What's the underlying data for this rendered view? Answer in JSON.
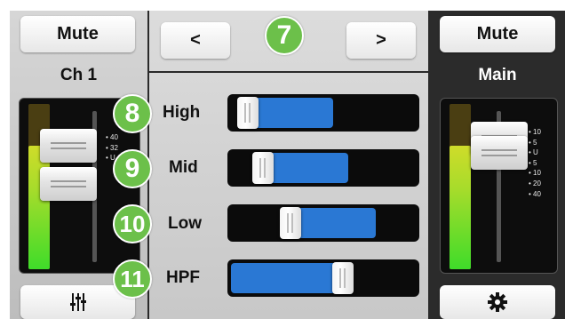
{
  "left_channel": {
    "mute_label": "Mute",
    "name": "Ch 1",
    "scale_marks": [
      "40",
      "32",
      "",
      "",
      "U",
      "",
      ""
    ],
    "fader_level": 0.58,
    "meter_level": 0.75,
    "settings_icon": "sliders-icon"
  },
  "center": {
    "prev_label": "<",
    "next_label": ">",
    "badge_top": "7",
    "eq": [
      {
        "badge": "8",
        "label": "High",
        "value": 0.04
      },
      {
        "badge": "9",
        "label": "Mid",
        "value": 0.13
      },
      {
        "badge": "10",
        "label": "Low",
        "value": 0.3
      },
      {
        "badge": "11",
        "label": "HPF",
        "value": 0.62
      }
    ]
  },
  "right_channel": {
    "mute_label": "Mute",
    "name": "Main",
    "scale_marks": [
      "10",
      "5",
      "U",
      "5",
      "10",
      "20",
      "40"
    ],
    "fader_level": 0.92,
    "meter_level": 0.75,
    "settings_icon": "gear-icon"
  },
  "colors": {
    "badge": "#6cc04a",
    "slider_fill": "#2a78d4",
    "dark_panel": "#2b2b2b"
  }
}
